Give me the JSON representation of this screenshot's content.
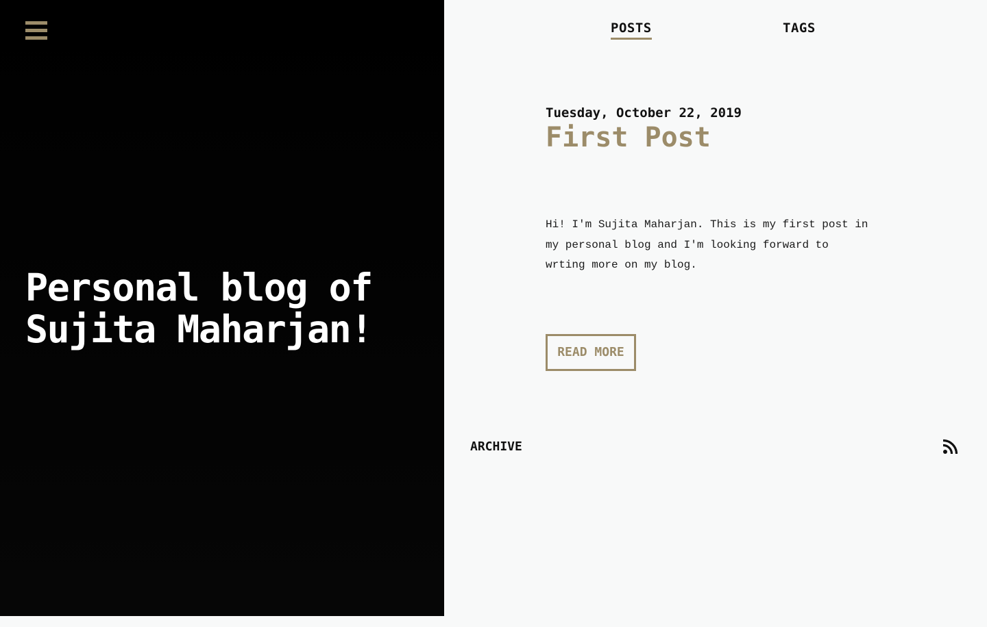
{
  "hero": {
    "title": "Personal blog of Sujita Maharjan!"
  },
  "nav": {
    "items": [
      {
        "label": "POSTS",
        "active": true
      },
      {
        "label": "TAGS",
        "active": false
      }
    ]
  },
  "post": {
    "date": "Tuesday, October 22, 2019",
    "title": "First Post",
    "excerpt": "Hi! I'm Sujita Maharjan. This is my first post in my personal blog and I'm looking forward to wrting more on my blog.",
    "read_more_label": "READ MORE"
  },
  "footer": {
    "archive_label": "ARCHIVE",
    "rss_icon": "rss-icon"
  },
  "theme": {
    "accent": "#9c8c69",
    "hero_background": "#000000",
    "page_background": "#f8f9f9",
    "text": "#111111"
  }
}
